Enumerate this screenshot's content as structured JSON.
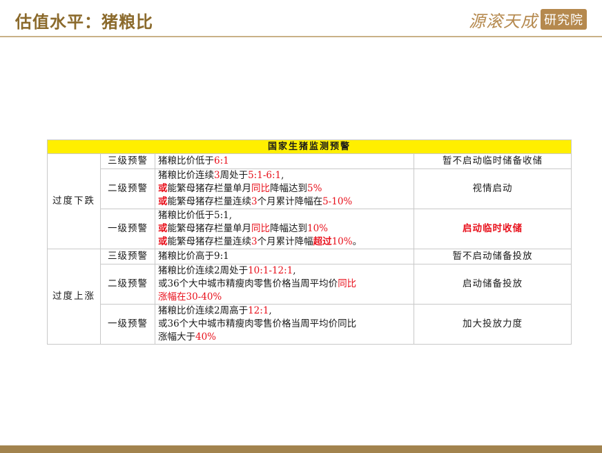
{
  "header": {
    "title": "估值水平：猪粮比",
    "logo_text": "源滚天成",
    "logo_seal": "研究院"
  },
  "table": {
    "title": "国家生猪监测预警",
    "groups": [
      {
        "category": "过度下跌",
        "rows": [
          {
            "level": "三级预警",
            "lines": [
              [
                {
                  "t": "猪粮比价低于"
                },
                {
                  "t": "6:1",
                  "c": "r"
                }
              ]
            ],
            "action": "暂不启动临时储备收储",
            "action_style": ""
          },
          {
            "level": "二级预警",
            "lines": [
              [
                {
                  "t": "猪粮比价连续"
                },
                {
                  "t": "3",
                  "c": "r"
                },
                {
                  "t": "周处于"
                },
                {
                  "t": "5:1-6:1",
                  "c": "r"
                },
                {
                  "t": ","
                }
              ],
              [
                {
                  "t": "或",
                  "c": "r-bold"
                },
                {
                  "t": "能繁母猪存栏量单月"
                },
                {
                  "t": "同比",
                  "c": "r"
                },
                {
                  "t": "降幅达到"
                },
                {
                  "t": "5%",
                  "c": "r"
                }
              ],
              [
                {
                  "t": "或",
                  "c": "r-bold"
                },
                {
                  "t": "能繁母猪存栏量连续"
                },
                {
                  "t": "3",
                  "c": "r"
                },
                {
                  "t": "个月累计降幅在"
                },
                {
                  "t": "5-10%",
                  "c": "r"
                }
              ]
            ],
            "action": "视情启动",
            "action_style": ""
          },
          {
            "level": "一级预警",
            "lines": [
              [
                {
                  "t": "猪粮比价低于5:1,"
                }
              ],
              [
                {
                  "t": "或",
                  "c": "r-bold"
                },
                {
                  "t": "能繁母猪存栏量单月"
                },
                {
                  "t": "同比",
                  "c": "r"
                },
                {
                  "t": "降幅达到"
                },
                {
                  "t": "10%",
                  "c": "r"
                }
              ],
              [
                {
                  "t": "或",
                  "c": "r-bold"
                },
                {
                  "t": "能繁母猪存栏量连续"
                },
                {
                  "t": "3",
                  "c": "r"
                },
                {
                  "t": "个月累计降幅"
                },
                {
                  "t": "超过",
                  "c": "r-bold"
                },
                {
                  "t": "10%",
                  "c": "r"
                },
                {
                  "t": "。"
                }
              ]
            ],
            "action": "启动临时收储",
            "action_style": "em"
          }
        ]
      },
      {
        "category": "过度上涨",
        "rows": [
          {
            "level": "三级预警",
            "lines": [
              [
                {
                  "t": "猪粮比价高于9:1"
                }
              ]
            ],
            "action": "暂不启动储备投放",
            "action_style": ""
          },
          {
            "level": "二级预警",
            "lines": [
              [
                {
                  "t": "猪粮比价连续2周处于"
                },
                {
                  "t": "10:1-12:1",
                  "c": "r"
                },
                {
                  "t": ","
                }
              ],
              [
                {
                  "t": "或36个大中城市精瘦肉零售价格当周平均价"
                },
                {
                  "t": "同比",
                  "c": "r"
                }
              ],
              [
                {
                  "t": "涨幅在",
                  "c": "r"
                },
                {
                  "t": "30-40%",
                  "c": "r"
                }
              ]
            ],
            "action": "启动储备投放",
            "action_style": ""
          },
          {
            "level": "一级预警",
            "lines": [
              [
                {
                  "t": "猪粮比价连续2周高于"
                },
                {
                  "t": "12:1",
                  "c": "r"
                },
                {
                  "t": ","
                }
              ],
              [
                {
                  "t": "或36个大中城市精瘦肉零售价格当周平均价同比"
                }
              ],
              [
                {
                  "t": "涨幅大于"
                },
                {
                  "t": "40%",
                  "c": "r"
                }
              ]
            ],
            "action": "加大投放力度",
            "action_style": ""
          }
        ]
      }
    ]
  }
}
